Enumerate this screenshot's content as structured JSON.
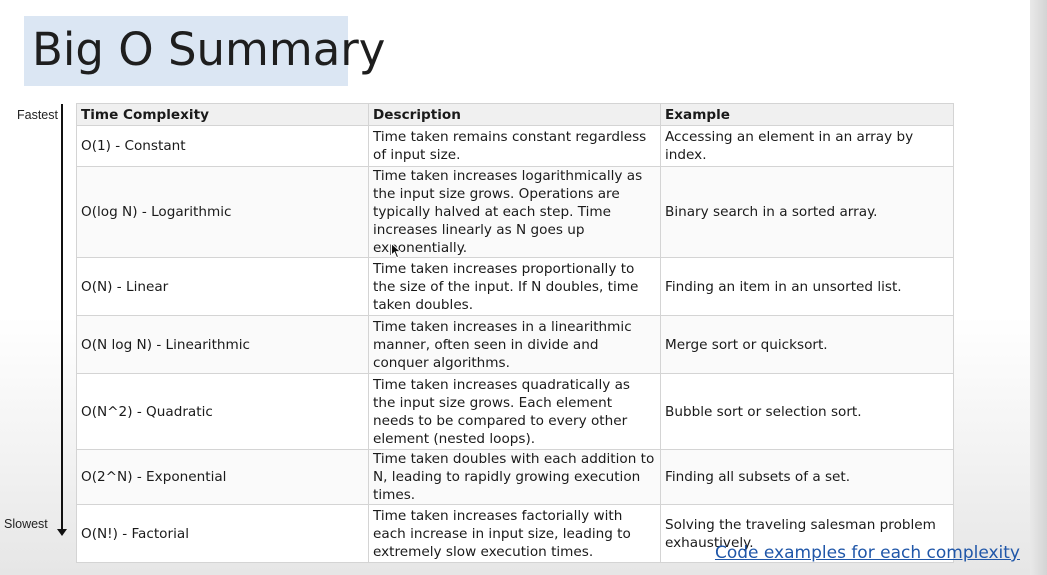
{
  "slide": {
    "title": "Big O Summary",
    "axis_top_label": "Fastest",
    "axis_bottom_label": "Slowest",
    "link_text": "Code examples for each complexity"
  },
  "table": {
    "headers": [
      "Time Complexity",
      "Description",
      "Example"
    ],
    "rows": [
      {
        "complexity": "O(1) - Constant",
        "description": "Time taken remains constant regardless of input size.",
        "example": "Accessing an element in an array by index."
      },
      {
        "complexity": "O(log N) - Logarithmic",
        "description": "Time taken increases logarithmically as the input size grows. Operations are typically halved at each step. Time increases linearly as N goes up exponentially.",
        "example": "Binary search in a sorted array."
      },
      {
        "complexity": "O(N) - Linear",
        "description": "Time taken increases proportionally to the size of the input. If N doubles, time taken doubles.",
        "example": "Finding an item in an unsorted list."
      },
      {
        "complexity": "O(N log N) - Linearithmic",
        "description": "Time taken increases in a linearithmic manner, often seen in divide and conquer algorithms.",
        "example": "Merge sort or quicksort."
      },
      {
        "complexity": "O(N^2) - Quadratic",
        "description": "Time taken increases quadratically as the input size grows. Each element needs to be compared to every other element (nested loops).",
        "example": "Bubble sort or selection sort."
      },
      {
        "complexity": "O(2^N) - Exponential",
        "description": "Time taken doubles with each addition to N, leading to rapidly growing execution times.",
        "example": "Finding all subsets of a set."
      },
      {
        "complexity": "O(N!) - Factorial",
        "description": "Time taken increases factorially with each increase in input size, leading to extremely slow execution times.",
        "example": "Solving the traveling salesman problem exhaustively."
      }
    ]
  },
  "icons": {
    "cursor": "mouse-pointer-icon",
    "axis_arrow": "arrow-down-icon"
  },
  "colors": {
    "title_background": "#dbe6f3",
    "link": "#1f56a8",
    "header_background": "#f0f0f0"
  }
}
